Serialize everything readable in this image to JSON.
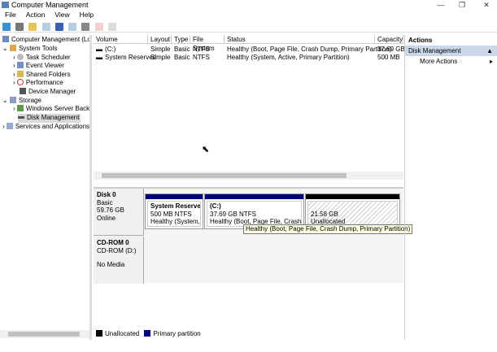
{
  "window": {
    "title": "Computer Management",
    "min": "—",
    "restore": "❐",
    "close": "✕"
  },
  "menu": [
    "File",
    "Action",
    "View",
    "Help"
  ],
  "tree": [
    {
      "label": "Computer Management (Local",
      "level": 0
    },
    {
      "label": "System Tools",
      "level": 1
    },
    {
      "label": "Task Scheduler",
      "level": 2
    },
    {
      "label": "Event Viewer",
      "level": 2
    },
    {
      "label": "Shared Folders",
      "level": 2
    },
    {
      "label": "Performance",
      "level": 2
    },
    {
      "label": "Device Manager",
      "level": 2
    },
    {
      "label": "Storage",
      "level": 1
    },
    {
      "label": "Windows Server Backup",
      "level": 2
    },
    {
      "label": "Disk Management",
      "level": 2
    },
    {
      "label": "Services and Applications",
      "level": 1
    }
  ],
  "volumes": {
    "columns": [
      "Volume",
      "Layout",
      "Type",
      "File System",
      "Status",
      "Capacity"
    ],
    "rows": [
      [
        "(C:)",
        "Simple",
        "Basic",
        "NTFS",
        "Healthy (Boot, Page File, Crash Dump, Primary Partition)",
        "37.69 GB"
      ],
      [
        "System Reserved",
        "Simple",
        "Basic",
        "NTFS",
        "Healthy (System, Active, Primary Partition)",
        "500 MB"
      ]
    ]
  },
  "disks": [
    {
      "name": "Disk 0",
      "type": "Basic",
      "size": "59.76 GB",
      "state": "Online",
      "partitions": [
        {
          "name": "System Reserved",
          "size": "500 MB NTFS",
          "status": "Healthy (System, Ac"
        },
        {
          "name": "(C:)",
          "size": "37.69 GB NTFS",
          "status": "Healthy (Boot, Page File, Crash Dum"
        },
        {
          "name": "",
          "size": "21.58 GB",
          "status": "Unallocated"
        }
      ]
    },
    {
      "name": "CD-ROM 0",
      "type": "CD-ROM (D:)",
      "state": "No Media"
    }
  ],
  "tooltip": "Healthy (Boot, Page File, Crash Dump, Primary Partition)",
  "legend": [
    "Unallocated",
    "Primary partition"
  ],
  "colors": {
    "primary": "#00007f",
    "unallocated": "#000000"
  },
  "actions": {
    "title": "Actions",
    "section": "Disk Management",
    "more": "More Actions"
  }
}
